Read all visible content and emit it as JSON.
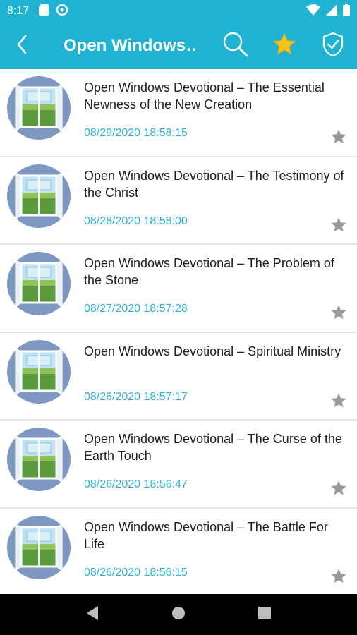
{
  "status_bar": {
    "time": "8:17",
    "icons_left": [
      "sd-card-icon",
      "sync-icon"
    ],
    "icons_right": [
      "wifi-icon",
      "signal-icon",
      "battery-icon"
    ]
  },
  "app_bar": {
    "title": "Open Windows…",
    "background": "#1fb3d1",
    "actions": [
      "search-icon",
      "star-favorites-icon",
      "shield-check-icon"
    ]
  },
  "items": [
    {
      "title": "Open Windows Devotional – The Essential Newness of the New Creation",
      "date": "08/29/2020 18:58:15"
    },
    {
      "title": "Open Windows Devotional – The Testimony of the Christ",
      "date": "08/28/2020 18:58:00"
    },
    {
      "title": "Open Windows Devotional – The Problem of the Stone",
      "date": "08/27/2020 18:57:28"
    },
    {
      "title": "Open Windows Devotional – Spiritual Ministry",
      "date": "08/26/2020 18:57:17"
    },
    {
      "title": "Open Windows Devotional – The Curse of the Earth Touch",
      "date": "08/26/2020 18:56:47"
    },
    {
      "title": "Open Windows Devotional – The Battle For Life",
      "date": "08/26/2020 18:56:15"
    }
  ],
  "colors": {
    "accent": "#1fb3d1",
    "date_text": "#2fb0cf",
    "favorite_star": "#f5c518",
    "inactive_star": "#9a9a9a"
  }
}
